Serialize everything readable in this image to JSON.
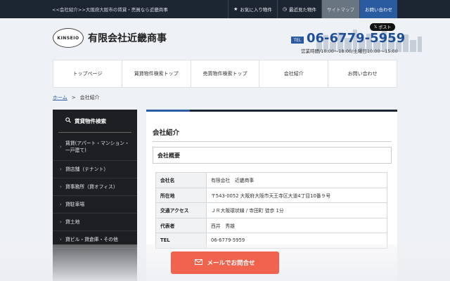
{
  "topbar": {
    "text": "<<会社紹介>>大阪府大阪市の賃貸・売買なら近畿商事",
    "favorites": "お気に入り物件",
    "recent": "最近見た物件",
    "sitemap": "サイトマップ",
    "contact": "お問い合わせ"
  },
  "header": {
    "logo_text": "KINSEIO",
    "company": "有限会社近畿商事",
    "post": "ポスト",
    "tel_badge": "TEL",
    "tel": "06-6779-5959",
    "hours": "営業時間/10:00～18:00/土曜日10:00～15:00"
  },
  "nav": [
    "トップページ",
    "賃貸物件検索トップ",
    "売買物件検索トップ",
    "会社紹介",
    "お問い合わせ"
  ],
  "breadcrumb": {
    "home": "ホーム",
    "sep": ">",
    "current": "会社紹介"
  },
  "sidebar": {
    "title": "賃貸物件検索",
    "items": [
      "賃貸(アパート・マンション・一戸建て)",
      "貸店舗（テナント）",
      "貸事務所（貸オフィス）",
      "貸駐車場",
      "貸土地",
      "貸ビル・貸倉庫・その他"
    ]
  },
  "main": {
    "title": "会社紹介",
    "section": "会社概要",
    "rows": [
      {
        "label": "会社名",
        "value": "有限会社　近畿商事"
      },
      {
        "label": "所在地",
        "value": "〒543-0052 大阪府大阪市天王寺区大道4丁目10番９号"
      },
      {
        "label": "交通アクセス",
        "value": "ＪＲ大阪環状線 / 寺田町 徒歩 1分"
      },
      {
        "label": "代表者",
        "value": "西井　秀雄"
      },
      {
        "label": "TEL",
        "value": "06-6779-5959"
      }
    ]
  },
  "mail_button": "メールでお問合せ",
  "colors": {
    "brand": "#2a5aa0",
    "dark": "#1c2632",
    "mail": "#f0634e"
  }
}
